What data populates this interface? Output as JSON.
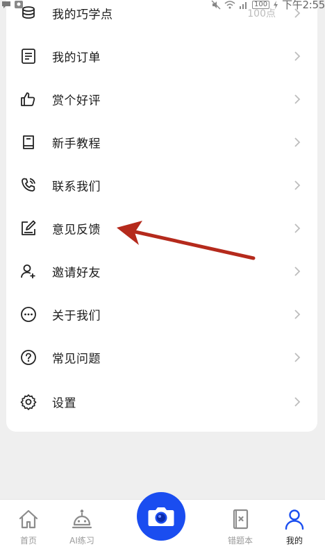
{
  "status_bar": {
    "time": "下午2:55",
    "battery": "100"
  },
  "menu": {
    "items": [
      {
        "id": "points",
        "label": "我的巧学点",
        "value": "100点",
        "icon": "coins-stack-icon"
      },
      {
        "id": "orders",
        "label": "我的订单",
        "icon": "document-icon"
      },
      {
        "id": "rate",
        "label": "赏个好评",
        "icon": "thumbs-up-icon"
      },
      {
        "id": "tutorial",
        "label": "新手教程",
        "icon": "book-icon"
      },
      {
        "id": "contact",
        "label": "联系我们",
        "icon": "phone-icon"
      },
      {
        "id": "feedback",
        "label": "意见反馈",
        "icon": "edit-note-icon"
      },
      {
        "id": "invite",
        "label": "邀请好友",
        "icon": "add-user-icon"
      },
      {
        "id": "about",
        "label": "关于我们",
        "icon": "ellipsis-circle-icon"
      },
      {
        "id": "faq",
        "label": "常见问题",
        "icon": "question-circle-icon"
      },
      {
        "id": "settings",
        "label": "设置",
        "icon": "gear-icon"
      }
    ]
  },
  "tabbar": {
    "home": "首页",
    "ai": "AI练习",
    "mistakes": "错题本",
    "mine": "我的",
    "active_color": "#1b4ff0",
    "camera_color": "#1a4df0"
  },
  "annotation": {
    "color": "#b52a1c"
  }
}
